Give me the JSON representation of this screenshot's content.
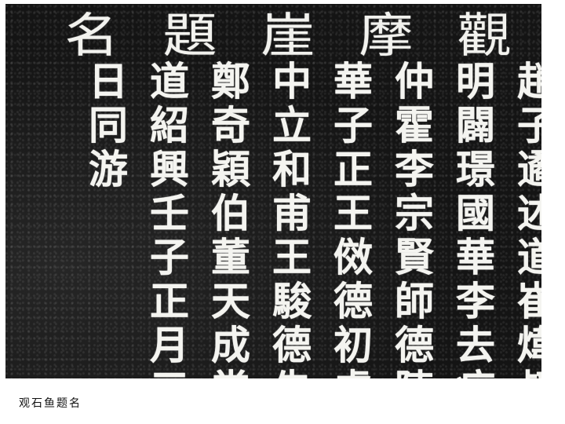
{
  "title": [
    "觀",
    "摩",
    "崖",
    "題",
    "名"
  ],
  "columns": [
    "趙子遹述道崔煒叔",
    "明闢璟國華李去病",
    "仲霍李宗賢師德陳",
    "華子正王傚德初虞",
    "中立和甫王駿德先",
    "鄭奇穎伯董天成常",
    "道紹興壬子正月三",
    "日同游"
  ],
  "caption": "观石鱼题名"
}
